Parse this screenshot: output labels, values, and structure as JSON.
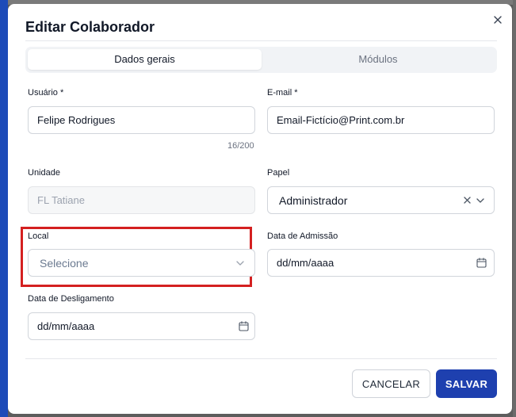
{
  "dialog": {
    "title": "Editar Colaborador",
    "tabs": [
      {
        "label": "Dados gerais",
        "active": true
      },
      {
        "label": "Módulos",
        "active": false
      }
    ]
  },
  "form": {
    "usuario": {
      "label": "Usuário *",
      "value": "Felipe Rodrigues",
      "counter": "16/200"
    },
    "email": {
      "label": "E-mail *",
      "value": "Email-Fictício@Print.com.br"
    },
    "unidade": {
      "label": "Unidade",
      "value": "FL Tatiane"
    },
    "papel": {
      "label": "Papel",
      "value": "Administrador"
    },
    "local": {
      "label": "Local",
      "placeholder": "Selecione"
    },
    "data_admissao": {
      "label": "Data de Admissão",
      "placeholder": "dd/mm/aaaa"
    },
    "data_desligamento": {
      "label": "Data de Desligamento",
      "placeholder": "dd/mm/aaaa"
    }
  },
  "footer": {
    "cancel_label": "CANCELAR",
    "save_label": "SALVAR"
  },
  "colors": {
    "primary": "#1e40af",
    "highlight": "#d42020"
  },
  "icons": [
    "close-icon",
    "clear-icon",
    "chevron-down-icon",
    "calendar-icon"
  ]
}
